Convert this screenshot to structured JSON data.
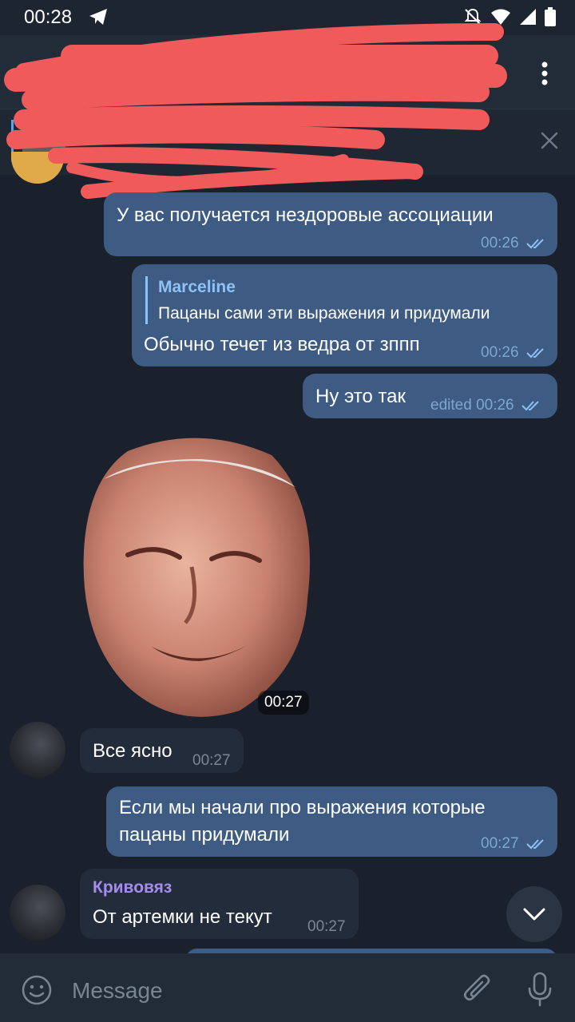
{
  "status_bar": {
    "time": "00:28",
    "icons": [
      "telegram-icon",
      "mute-icon",
      "wifi-icon",
      "signal-icon",
      "battery-icon"
    ]
  },
  "header": {
    "back_icon": "arrow-left-icon",
    "menu_icon": "more-vertical-icon"
  },
  "pinned": {
    "close_icon": "close-icon"
  },
  "messages": [
    {
      "type": "outgoing",
      "text": "У вас получается нездоровые ассоциации",
      "time": "00:26"
    },
    {
      "type": "outgoing",
      "reply_name": "Marceline",
      "reply_text": "Пацаны сами эти выражения и придумали",
      "text": "Обычно течет из ведра от зппп",
      "time": "00:26"
    },
    {
      "type": "outgoing",
      "text": "Ну это так",
      "edited": "edited",
      "time": "00:26"
    },
    {
      "type": "sticker",
      "time": "00:27"
    },
    {
      "type": "incoming",
      "text": "Все ясно",
      "time": "00:27"
    },
    {
      "type": "outgoing",
      "text_line1": "Если мы начали про выражения которые",
      "text_line2": "пацаны придумали",
      "time": "00:27"
    },
    {
      "type": "incoming",
      "sender": "Кривовяз",
      "text": "От артемки не текут",
      "time": "00:27"
    }
  ],
  "composer": {
    "placeholder": "Message",
    "emoji_icon": "emoji-icon",
    "attach_icon": "paperclip-icon",
    "mic_icon": "microphone-icon"
  },
  "colors": {
    "background": "#1a212c",
    "outgoing": "#3d5b83",
    "incoming": "#232c3a",
    "accent": "#8ec1f5",
    "sender": "#a78cf0"
  }
}
